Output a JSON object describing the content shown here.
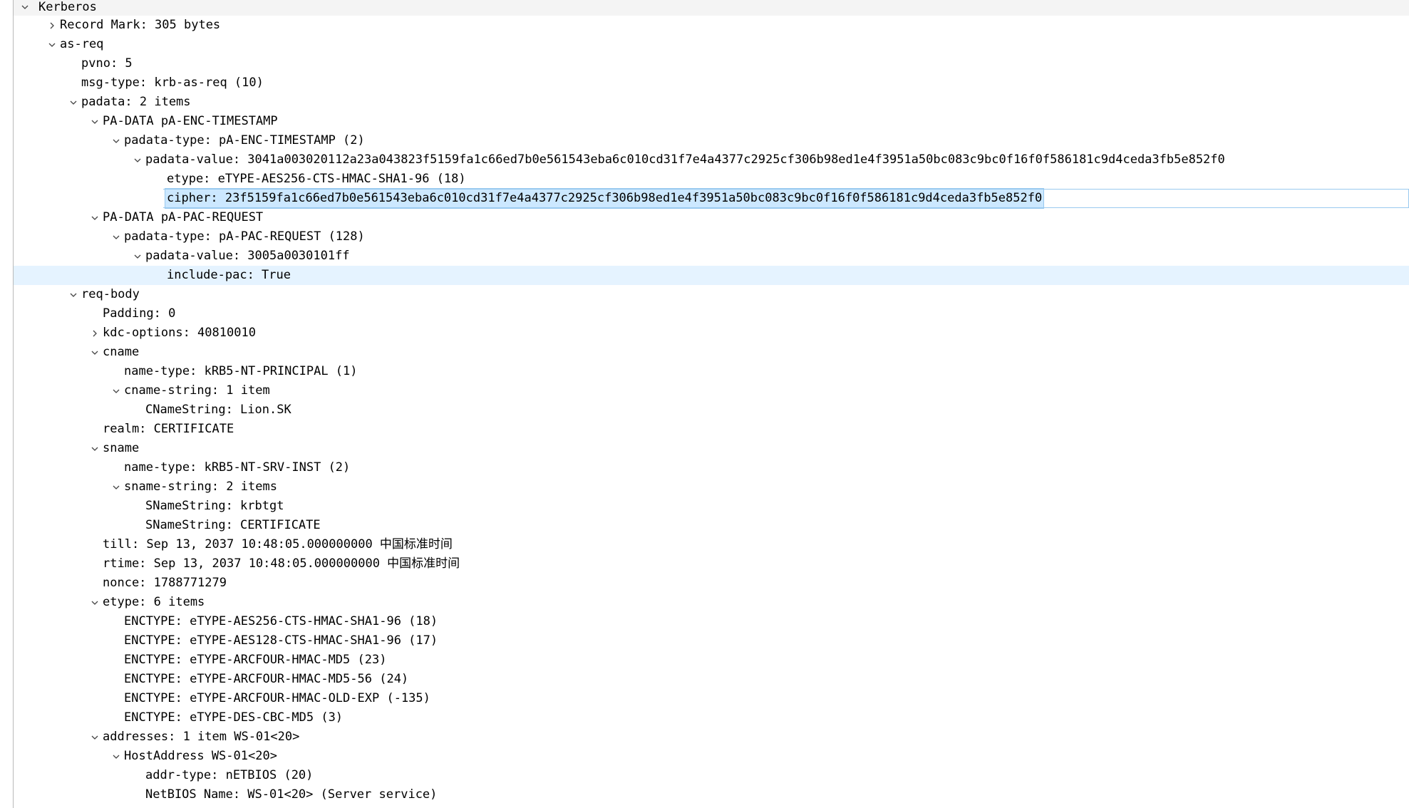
{
  "tree": {
    "root": "Kerberos",
    "record_mark": "Record Mark: 305 bytes",
    "as_req": "as-req",
    "pvno": "pvno: 5",
    "msg_type": "msg-type: krb-as-req (10)",
    "padata": "padata: 2 items",
    "pa_data_1": "PA-DATA pA-ENC-TIMESTAMP",
    "pa_data_1_type": "padata-type: pA-ENC-TIMESTAMP (2)",
    "pa_data_1_value": "padata-value: 3041a003020112a23a043823f5159fa1c66ed7b0e561543eba6c010cd31f7e4a4377c2925cf306b98ed1e4f3951a50bc083c9bc0f16f0f586181c9d4ceda3fb5e852f0",
    "etype_value": "etype: eTYPE-AES256-CTS-HMAC-SHA1-96 (18)",
    "cipher": "cipher: 23f5159fa1c66ed7b0e561543eba6c010cd31f7e4a4377c2925cf306b98ed1e4f3951a50bc083c9bc0f16f0f586181c9d4ceda3fb5e852f0",
    "pa_data_2": "PA-DATA pA-PAC-REQUEST",
    "pa_data_2_type": "padata-type: pA-PAC-REQUEST (128)",
    "pa_data_2_value": "padata-value: 3005a0030101ff",
    "include_pac": "include-pac: True",
    "req_body": "req-body",
    "padding": "Padding: 0",
    "kdc_options": "kdc-options: 40810010",
    "cname": "cname",
    "cname_name_type": "name-type: kRB5-NT-PRINCIPAL (1)",
    "cname_string": "cname-string: 1 item",
    "cname_string_value": "CNameString: Lion.SK",
    "realm": "realm: CERTIFICATE",
    "sname": "sname",
    "sname_name_type": "name-type: kRB5-NT-SRV-INST (2)",
    "sname_string": "sname-string: 2 items",
    "sname_string_1": "SNameString: krbtgt",
    "sname_string_2": "SNameString: CERTIFICATE",
    "till": "till: Sep 13, 2037 10:48:05.000000000 中国标准时间",
    "rtime": "rtime: Sep 13, 2037 10:48:05.000000000 中国标准时间",
    "nonce": "nonce: 1788771279",
    "etype": "etype: 6 items",
    "enctypes": [
      "ENCTYPE: eTYPE-AES256-CTS-HMAC-SHA1-96 (18)",
      "ENCTYPE: eTYPE-AES128-CTS-HMAC-SHA1-96 (17)",
      "ENCTYPE: eTYPE-ARCFOUR-HMAC-MD5 (23)",
      "ENCTYPE: eTYPE-ARCFOUR-HMAC-MD5-56 (24)",
      "ENCTYPE: eTYPE-ARCFOUR-HMAC-OLD-EXP (-135)",
      "ENCTYPE: eTYPE-DES-CBC-MD5 (3)"
    ],
    "addresses": "addresses: 1 item WS-01<20>",
    "host_address": "HostAddress WS-01<20>",
    "addr_type": "addr-type: nETBIOS (20)",
    "netbios_name": "NetBIOS Name: WS-01<20> (Server service)"
  },
  "icons": {
    "expanded": "chevron-down-icon",
    "collapsed": "chevron-right-icon"
  },
  "colors": {
    "selection_background": "#cce8ff",
    "selection_border": "#99c9ef",
    "related_highlight": "#e5f3ff"
  }
}
